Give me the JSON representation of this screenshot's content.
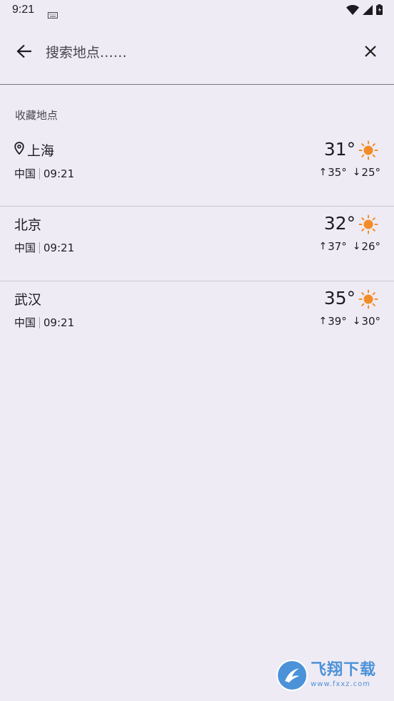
{
  "status_bar": {
    "time": "9:21"
  },
  "search": {
    "placeholder": "搜索地点……",
    "value": ""
  },
  "section": {
    "title": "收藏地点"
  },
  "locations": [
    {
      "name": "上海",
      "is_current": true,
      "country": "中国",
      "time": "09:21",
      "temp": "31°",
      "high": "35°",
      "low": "25°",
      "icon": "sun-icon"
    },
    {
      "name": "北京",
      "is_current": false,
      "country": "中国",
      "time": "09:21",
      "temp": "32°",
      "high": "37°",
      "low": "26°",
      "icon": "sun-icon"
    },
    {
      "name": "武汉",
      "is_current": false,
      "country": "中国",
      "time": "09:21",
      "temp": "35°",
      "high": "39°",
      "low": "30°",
      "icon": "sun-icon"
    }
  ],
  "watermark": {
    "title": "飞翔下载",
    "url": "www.fxxz.com"
  },
  "colors": {
    "background": "#EFEBF4",
    "sun": "#F28C28",
    "divider": "#CAC4D0"
  }
}
